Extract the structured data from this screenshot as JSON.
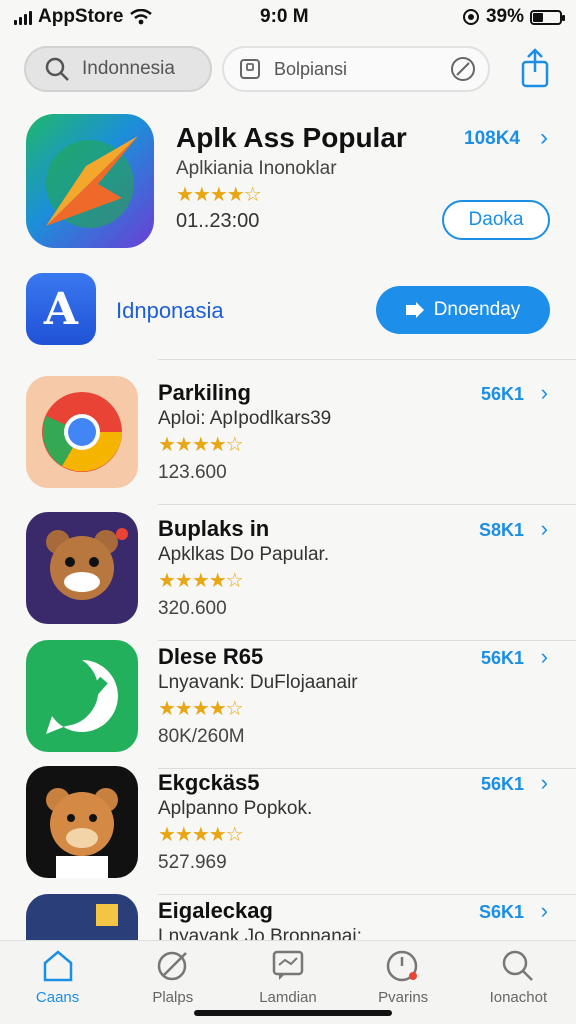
{
  "status": {
    "carrier": "AppStore",
    "time": "9:0 M",
    "battery": "39%",
    "battery_level": 0.39
  },
  "search": {
    "primary": "Indonnesia",
    "secondary": "Bolpiansi"
  },
  "featured": {
    "title": "Aplk Ass Popular",
    "subtitle": "Aplkiania Inonoklar",
    "stars": "★★★★☆",
    "date": "01..23:00",
    "count": "108K4",
    "open_label": "Daoka"
  },
  "banner": {
    "icon_letter": "A",
    "label": "Idnponasia",
    "download_label": "Dnoenday"
  },
  "apps": [
    {
      "name": "Parkiling",
      "subtitle": "Aploi: ApIpodlkars39",
      "stars": "★★★★☆",
      "count": "123.600",
      "downloads": "56K1",
      "icon": "chrome-icon",
      "icon_color": "#e94335"
    },
    {
      "name": "Buplaks in",
      "subtitle": "Apklkas Do Papular.",
      "stars": "★★★★☆",
      "count": "320.600",
      "downloads": "S8K1",
      "icon": "bear-game-icon",
      "icon_color": "#3b2a6b"
    },
    {
      "name": "Dlese R65",
      "subtitle": "Lnyavank: DuFlojaanair",
      "stars": "★★★★☆",
      "count": "80K/260M",
      "downloads": "56K1",
      "icon": "whatsapp-icon",
      "icon_color": "#23b05d"
    },
    {
      "name": "Ekgckäs5",
      "subtitle": "Aplpanno Popkok.",
      "stars": "★★★★☆",
      "count": "527.969",
      "downloads": "56K1",
      "icon": "bear-icon",
      "icon_color": "#111111"
    },
    {
      "name": "Eigaleckag",
      "subtitle": "Lnyavank Jo Bropnanai:",
      "stars": "★★★★☆",
      "count": "",
      "downloads": "S6K1",
      "icon": "game-icon",
      "icon_color": "#2a3f7a"
    }
  ],
  "tabs": [
    {
      "label": "Caans",
      "icon": "home-icon",
      "active": true
    },
    {
      "label": "Plalps",
      "icon": "compass-icon",
      "active": false
    },
    {
      "label": "Lamdian",
      "icon": "chat-icon",
      "active": false
    },
    {
      "label": "Pvarins",
      "icon": "clock-icon",
      "active": false
    },
    {
      "label": "Ionachot",
      "icon": "search-icon",
      "active": false
    }
  ],
  "colors": {
    "accent": "#1b8fe6",
    "star": "#e9a613"
  }
}
